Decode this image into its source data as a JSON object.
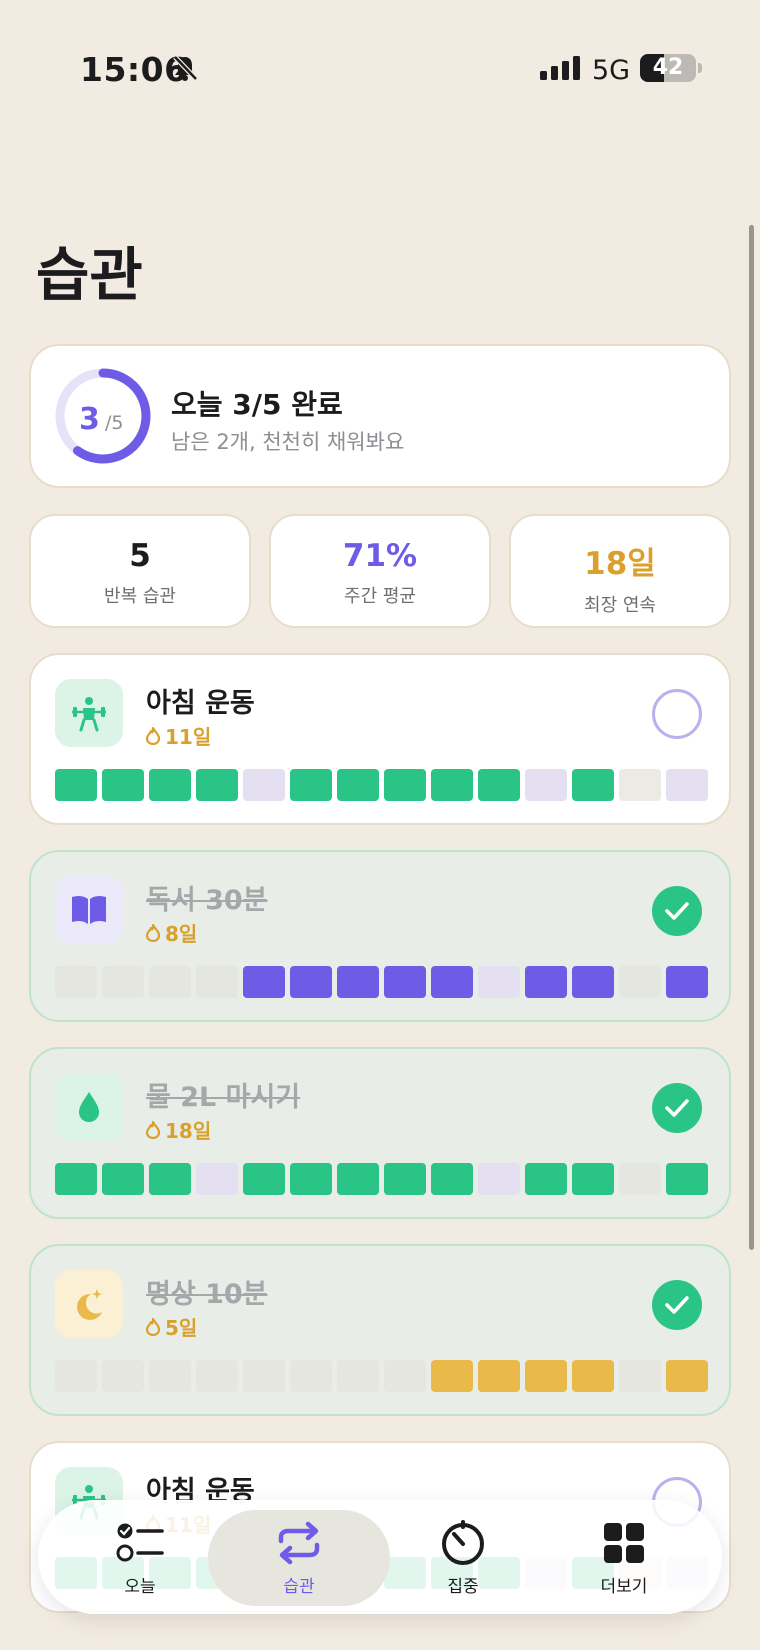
{
  "status_bar": {
    "time": "15:06",
    "network": "5G",
    "battery": "42",
    "battery_level": 0.42
  },
  "header": {
    "title": "습관"
  },
  "summary": {
    "done": "3",
    "total": "/5",
    "progress": 0.6,
    "title": "오늘 3/5 완료",
    "subtitle": "남은 2개, 천천히 채워봐요"
  },
  "stats": [
    {
      "value": "5",
      "label": "반복 습관",
      "color": "#1C1C1E"
    },
    {
      "value": "71%",
      "label": "주간 평균",
      "color": "#6E5CE6"
    },
    {
      "value": "18일",
      "label": "최장 연속",
      "color": "#D9A02E"
    }
  ],
  "habits": [
    {
      "name": "아침 운동",
      "streak": "11일",
      "done": false,
      "color": "green",
      "icon": "weightlifting-icon",
      "history": [
        1,
        1,
        1,
        1,
        2,
        1,
        1,
        1,
        1,
        1,
        2,
        1,
        0,
        2
      ]
    },
    {
      "name": "독서 30분",
      "streak": "8일",
      "done": true,
      "color": "purple",
      "icon": "book-icon",
      "history": [
        0,
        0,
        0,
        0,
        1,
        1,
        1,
        1,
        1,
        2,
        1,
        1,
        0,
        1
      ]
    },
    {
      "name": "물 2L 마시기",
      "streak": "18일",
      "done": true,
      "color": "green",
      "icon": "water-drop-icon",
      "history": [
        1,
        1,
        1,
        2,
        1,
        1,
        1,
        1,
        1,
        2,
        1,
        1,
        0,
        1
      ]
    },
    {
      "name": "명상 10분",
      "streak": "5일",
      "done": true,
      "color": "yellow",
      "icon": "moon-icon",
      "history": [
        0,
        0,
        0,
        0,
        0,
        0,
        0,
        0,
        1,
        1,
        1,
        1,
        0,
        1
      ]
    },
    {
      "name": "아침 운동",
      "streak": "11일",
      "done": false,
      "color": "green",
      "icon": "weightlifting-icon",
      "history": [
        1,
        1,
        1,
        1,
        2,
        1,
        1,
        1,
        1,
        1,
        2,
        1,
        0,
        2
      ]
    }
  ],
  "tabs": [
    {
      "label": "오늘",
      "icon": "checklist-icon",
      "active": false
    },
    {
      "label": "습관",
      "icon": "repeat-icon",
      "active": true
    },
    {
      "label": "집중",
      "icon": "timer-icon",
      "active": false
    },
    {
      "label": "더보기",
      "icon": "grid-icon",
      "active": false
    }
  ]
}
